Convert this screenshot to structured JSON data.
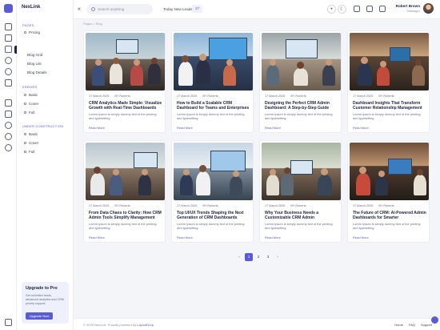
{
  "brand": {
    "name": "NexLink",
    "accent": "#5b5bd6"
  },
  "rail": {
    "icons": [
      "home-icon",
      "layers-icon",
      "pages-icon",
      "wallet-icon",
      "rocket-icon",
      "box-icon",
      "grid-icon",
      "chart-icon",
      "chat-icon",
      "settings-icon",
      "plus-icon",
      "logout-icon"
    ],
    "tooltip": "Pages"
  },
  "sidebar": {
    "sections": [
      {
        "title": "Pages",
        "items": [
          "Pricing"
        ]
      },
      {
        "title": "",
        "items": [
          "Blog Grid",
          "Blog List",
          "Blog Details"
        ]
      },
      {
        "title": "Errors",
        "items": [
          "Basic",
          "Cover",
          "Full"
        ]
      },
      {
        "title": "Under Construction",
        "items": [
          "Basic",
          "Cover",
          "Full"
        ]
      }
    ],
    "promo": {
      "title": "Upgrade to Pro",
      "text": "Get unlimited leads, advanced analytics and CRM priority support.",
      "button": "Upgrade Now"
    }
  },
  "topbar": {
    "search_placeholder": "Search anything",
    "leads_label": "Today New Leads",
    "leads_count": "27",
    "user_name": "Robert Brown",
    "user_role": "Manager"
  },
  "breadcrumb": "Pages > Blog",
  "posts": [
    {
      "date": "17 March 2025",
      "author": "BY Roberts",
      "title": "CRM Analytics Made Simple: Visualize Growth with Real-Time Dashboards",
      "desc": "Lorem Ipsum is simply dummy text of the printing and typesetting.",
      "more": "Read More"
    },
    {
      "date": "17 March 2025",
      "author": "BY Roberts",
      "title": "How to Build a Scalable CRM Dashboard for Teams and Enterprises",
      "desc": "Lorem Ipsum is simply dummy text of the printing and typesetting.",
      "more": "Read More"
    },
    {
      "date": "17 March 2025",
      "author": "BY Roberts",
      "title": "Designing the Perfect CRM Admin Dashboard: A Step-by-Step Guide",
      "desc": "Lorem Ipsum is simply dummy text of the printing and typesetting.",
      "more": "Read More"
    },
    {
      "date": "17 March 2025",
      "author": "BY Roberts",
      "title": "Dashboard Insights That Transform Customer Relationship Management",
      "desc": "Lorem Ipsum is simply dummy text of the printing and typesetting.",
      "more": "Read More"
    },
    {
      "date": "17 March 2025",
      "author": "BY Roberts",
      "title": "From Data Chaos to Clarity: How CRM Admin Tools Simplify Management",
      "desc": "Lorem Ipsum is simply dummy text of the printing and typesetting.",
      "more": "Read More"
    },
    {
      "date": "17 March 2025",
      "author": "BY Roberts",
      "title": "Top UI/UX Trends Shaping the Next Generation of CRM Dashboards",
      "desc": "Lorem Ipsum is simply dummy text of the printing and typesetting.",
      "more": "Read More"
    },
    {
      "date": "17 March 2025",
      "author": "BY Roberts",
      "title": "Why Your Business Needs a Customizable CRM Admin",
      "desc": "Lorem Ipsum is simply dummy text of the printing and typesetting.",
      "more": "Read More"
    },
    {
      "date": "17 March 2025",
      "author": "BY Roberts",
      "title": "The Future of CRM: AI-Powered Admin Dashboards for Smarter",
      "desc": "Lorem Ipsum is simply dummy text of the printing and typesetting.",
      "more": "Read More"
    }
  ],
  "pagination": {
    "prev": "‹",
    "pages": [
      "1",
      "2",
      "3"
    ],
    "next": "›",
    "active": "1"
  },
  "footer": {
    "copyright": "© 2025 NexLink. Proudly powered by",
    "powered_by": "LayoutDrop",
    "links": [
      "Home",
      "FAQ",
      "Support"
    ]
  }
}
